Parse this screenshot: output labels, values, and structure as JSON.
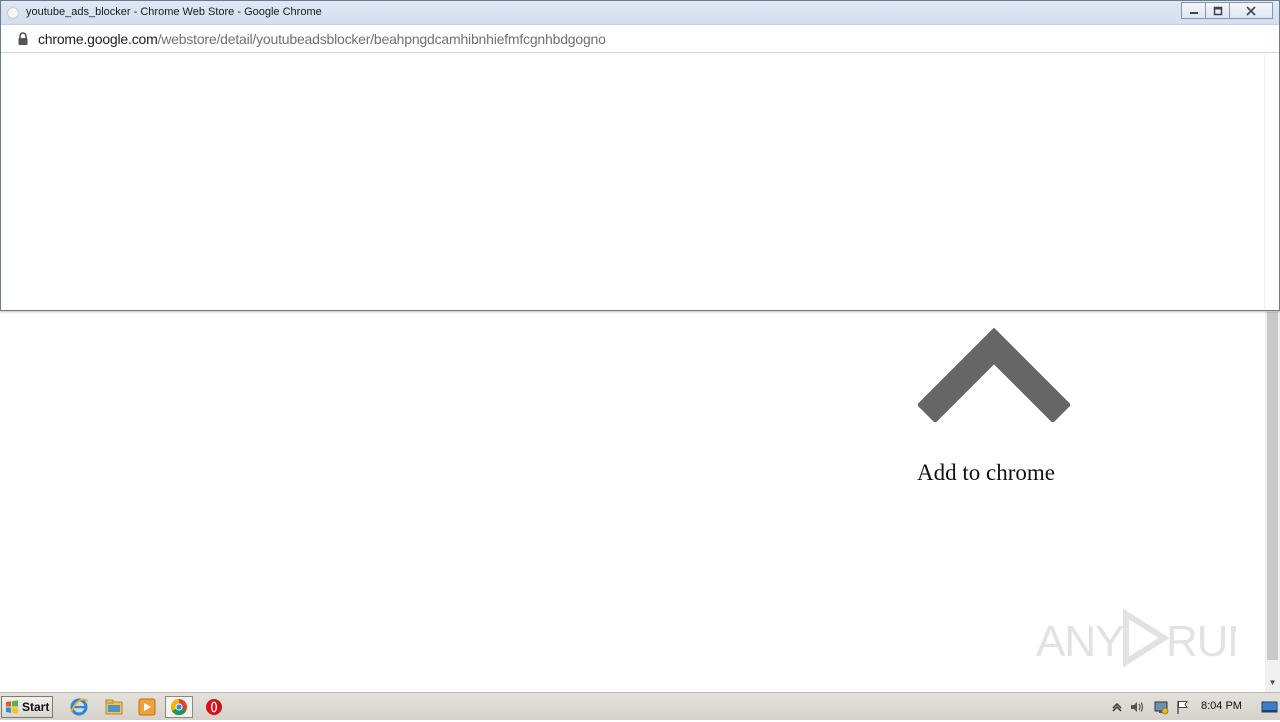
{
  "window": {
    "title": "youtube_ads_blocker - Chrome Web Store - Google Chrome",
    "icon": "page-favicon-icon"
  },
  "address": {
    "host": "chrome.google.com",
    "path": "/webstore/detail/youtubeadsblocker/beahpngdcamhibnhiefmfcgnhbdgogno",
    "icon": "lock-icon"
  },
  "page": {
    "arrow_icon": "chevron-up-icon",
    "add_label": "Add to chrome",
    "arrow_color": "#666666"
  },
  "watermark": {
    "text": "ANY RUN"
  },
  "taskbar": {
    "start_label": "Start",
    "pinned": [
      "internet-explorer-icon",
      "file-explorer-icon",
      "media-player-icon",
      "chrome-icon",
      "opera-icon"
    ],
    "clock": "8:04 PM"
  }
}
